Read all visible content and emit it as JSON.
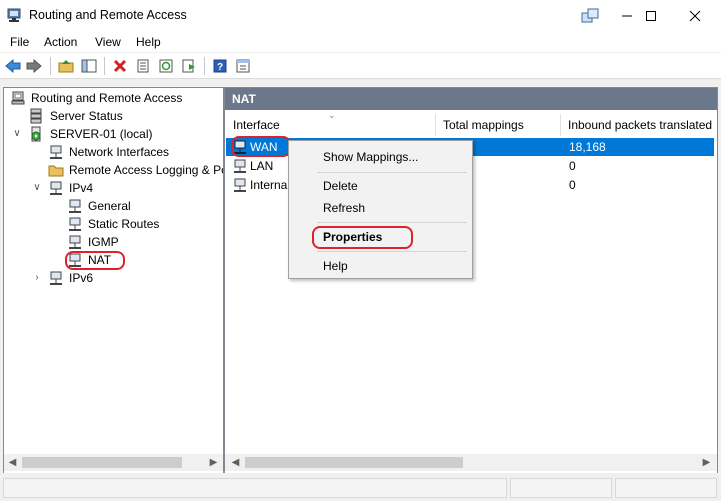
{
  "window": {
    "title": "Routing and Remote Access"
  },
  "menu": [
    "File",
    "Action",
    "View",
    "Help"
  ],
  "tree": {
    "root": "Routing and Remote Access",
    "server_status": "Server Status",
    "server": "SERVER-01 (local)",
    "network_interfaces": "Network Interfaces",
    "remote_logging": "Remote Access Logging & Policies",
    "ipv4": "IPv4",
    "general": "General",
    "static_routes": "Static Routes",
    "igmp": "IGMP",
    "nat": "NAT",
    "ipv6": "IPv6"
  },
  "nat_panel": {
    "header": "NAT",
    "columns": [
      "Interface",
      "Total mappings",
      "Inbound packets translated"
    ],
    "rows": [
      {
        "interface": "WAN",
        "total": "",
        "inbound": "18,168"
      },
      {
        "interface": "LAN",
        "total": "",
        "inbound": "0"
      },
      {
        "interface": "Internal",
        "total": "",
        "inbound": "0"
      }
    ]
  },
  "context_menu": {
    "show_mappings": "Show Mappings...",
    "delete": "Delete",
    "refresh": "Refresh",
    "properties": "Properties",
    "help": "Help"
  },
  "colors": {
    "selection": "#0078d7",
    "panel_header": "#6b778b",
    "highlight_ring": "#d9242b"
  }
}
